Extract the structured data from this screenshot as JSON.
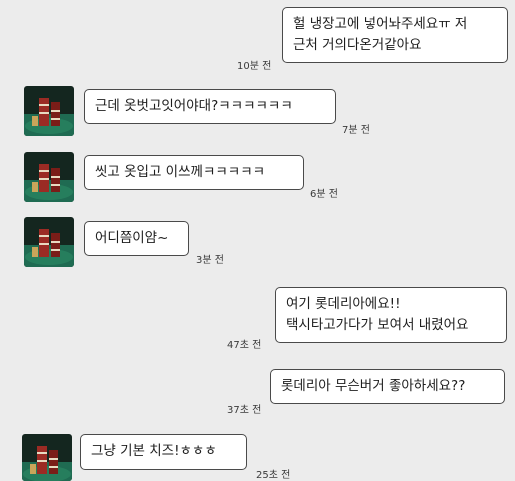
{
  "messages": [
    {
      "sender": "me",
      "lines": [
        "헐 냉장고에 넣어놔주세요ㅠ 저",
        "근처 거의다온거같아요"
      ],
      "time": "10분 전"
    },
    {
      "sender": "other",
      "lines": [
        "근데 옷벗고잇어야대?ㅋㅋㅋㅋㅋㅋ"
      ],
      "time": "7분 전"
    },
    {
      "sender": "other",
      "lines": [
        "씻고 옷입고 이쓰께ㅋㅋㅋㅋㅋ"
      ],
      "time": "6분 전"
    },
    {
      "sender": "other",
      "lines": [
        "어디쯤이얌~"
      ],
      "time": "3분 전"
    },
    {
      "sender": "me",
      "lines": [
        "여기 롯데리아에요!!",
        "택시타고가다가 보여서 내렸어요"
      ],
      "time": "47초 전"
    },
    {
      "sender": "me",
      "lines": [
        "롯데리아 무슨버거 좋아하세요??"
      ],
      "time": "37초 전"
    },
    {
      "sender": "other",
      "lines": [
        "그냥 기본 치즈!ㅎㅎㅎ"
      ],
      "time": "25초 전"
    }
  ],
  "avatar": {
    "icon": "profile-photo-icon",
    "colors": {
      "table": "#1f6b52",
      "chips": "#9b2b24",
      "background": "#14261f"
    }
  }
}
